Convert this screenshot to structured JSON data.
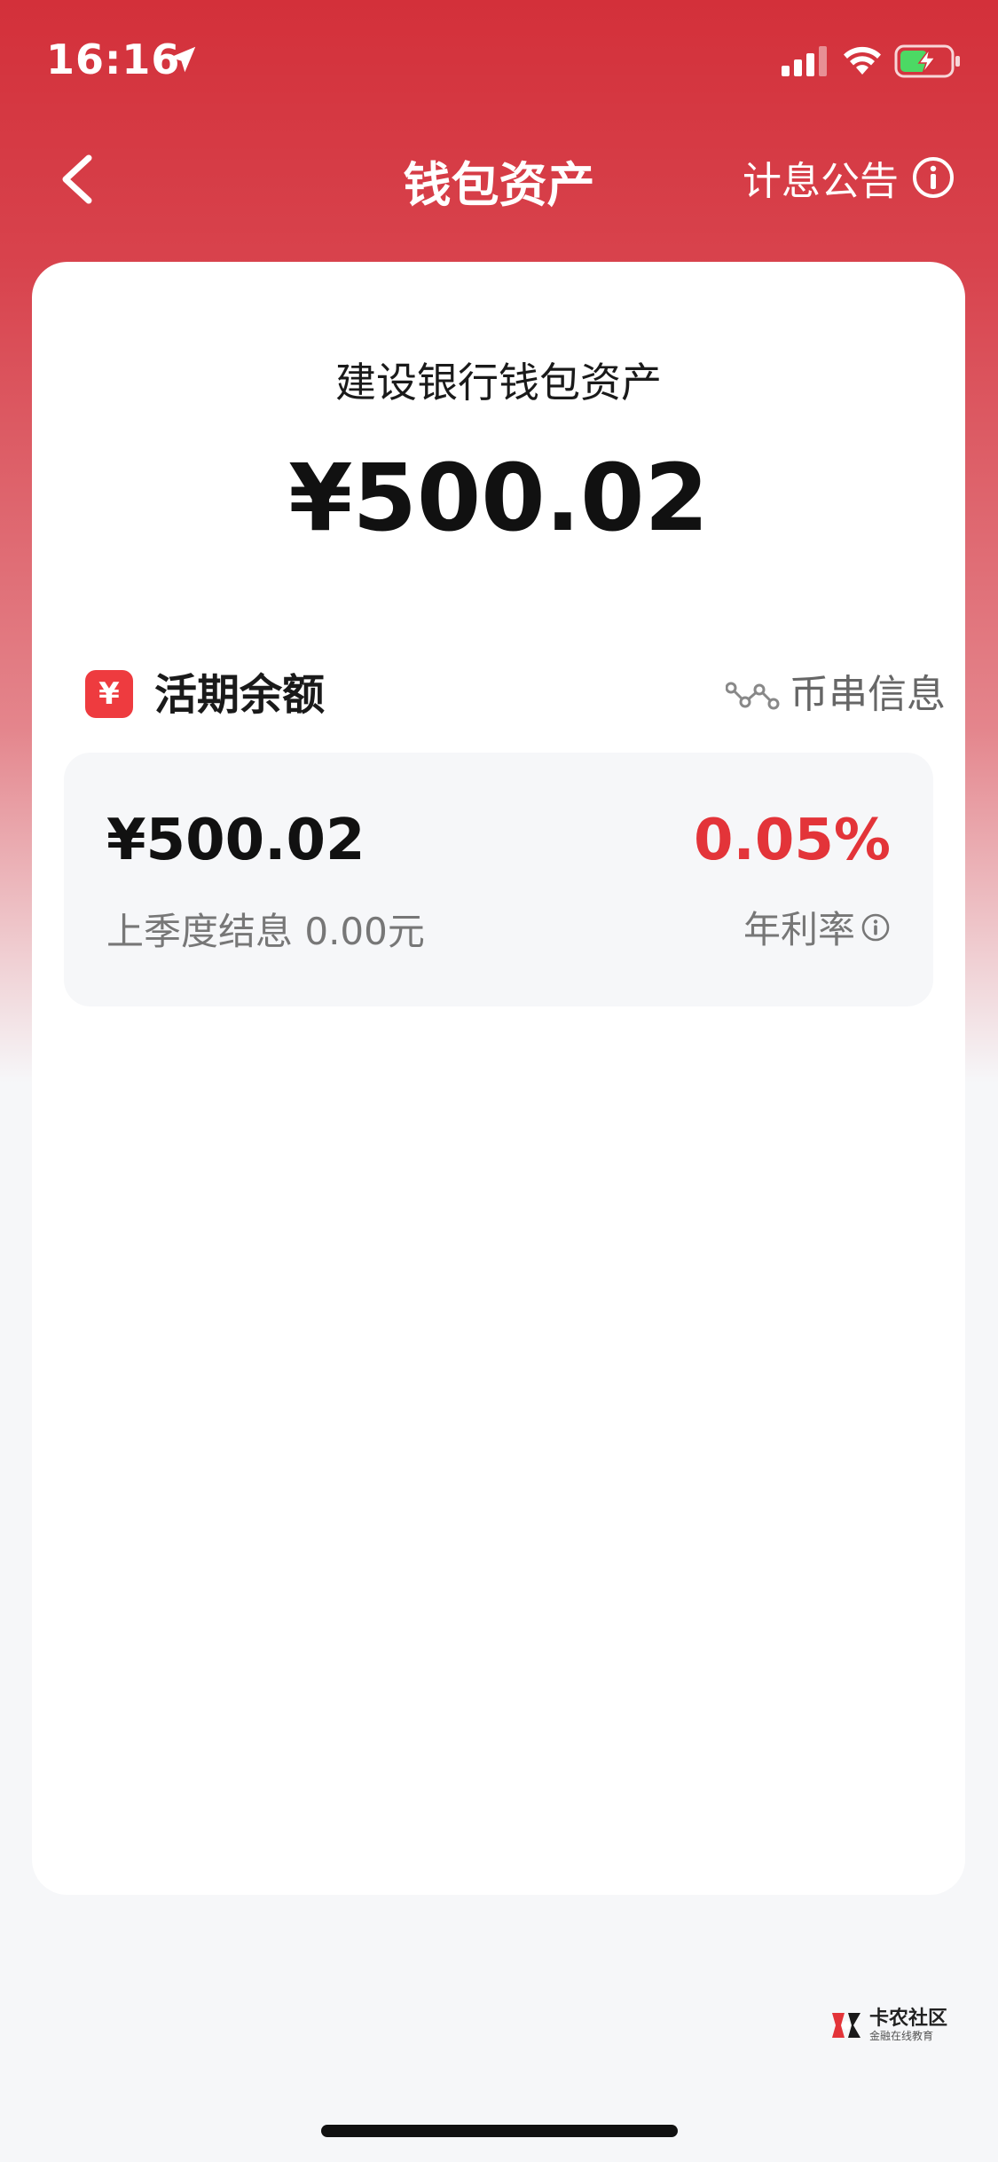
{
  "status_bar": {
    "time": "16:16"
  },
  "nav": {
    "title": "钱包资产",
    "notice_label": "计息公告"
  },
  "card": {
    "heading": "建设银行钱包资产",
    "total": "¥500.02"
  },
  "section": {
    "yuan_symbol": "¥",
    "title": "活期余额",
    "link_label": "币串信息"
  },
  "balance": {
    "amount": "¥500.02",
    "interest": "上季度结息 0.00元",
    "rate": "0.05%",
    "rate_label": "年利率"
  },
  "watermark": {
    "title": "卡农社区",
    "subtitle": "金融在线教育"
  },
  "colors": {
    "brand_red": "#d3303a",
    "rate_red": "#e33439",
    "panel_bg": "#f6f7f9",
    "battery_green": "#4cd964"
  }
}
